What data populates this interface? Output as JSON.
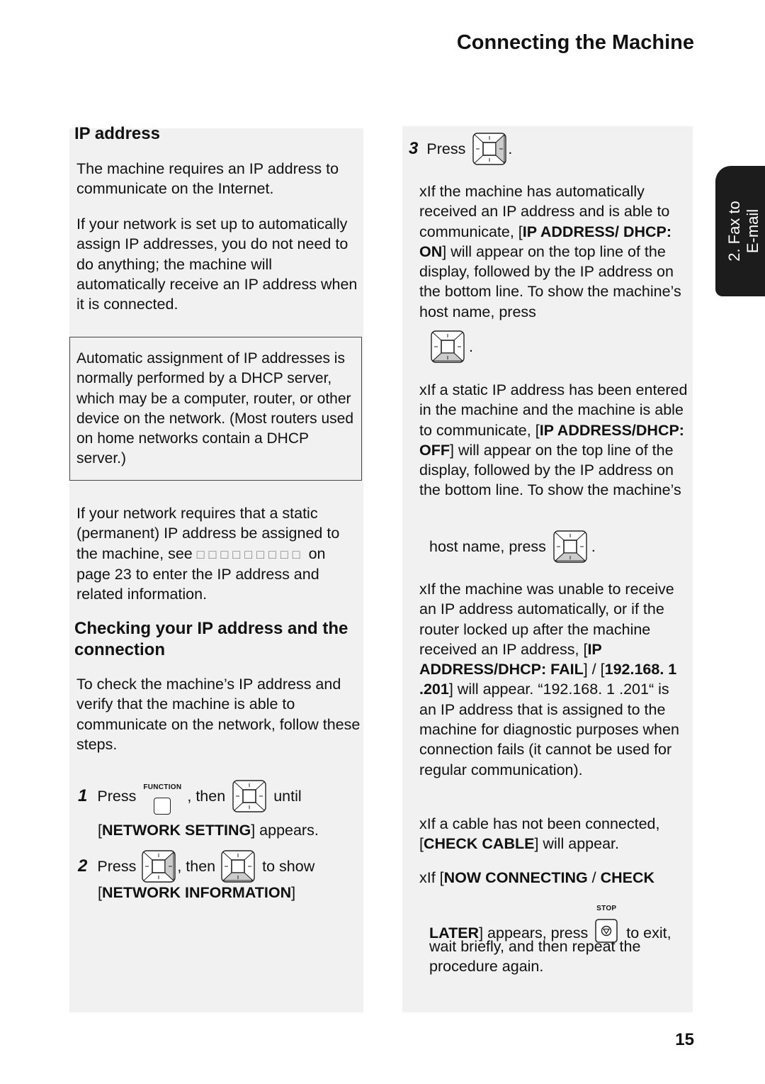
{
  "header": {
    "title": "Connecting the Machine"
  },
  "side_tab": {
    "line1": "2. Fax to",
    "line2": "E-mail"
  },
  "left": {
    "ip_heading": "IP address",
    "p1": "The machine requires an IP address to communicate on the Internet.",
    "p2": "If your network is set up to automatically assign IP addresses, you do not need to do anything; the machine will automatically receive an IP address when it is connected.",
    "note": "Automatic assignment of IP addresses is normally performed by a DHCP server, which may be a computer, router, or other device on the network. (Most routers used on home networks contain a DHCP server.)",
    "p3_a": "If your network requires that a static (permanent) IP address be assigned to the machine, see",
    "p3_glyphs": "□□□□□□□□□",
    "p3_b": "on page 23 to enter the IP address and related information.",
    "check_heading": "Checking your IP address and the connection",
    "p4": "To check the machine’s IP address and verify that the machine is able to communicate on the network, follow these steps.",
    "step1": {
      "num": "1",
      "press": "Press",
      "key_label": "FUNCTION",
      "then": ", then",
      "until": "until",
      "bracket_open": "[",
      "bold": "NETWORK SETTING",
      "rest": "] appears."
    },
    "step2": {
      "num": "2",
      "press": "Press",
      "then": ", then",
      "to_show": "to show",
      "bracket_open": "[",
      "bold": "NETWORK INFORMATION",
      "bracket_close": "]"
    }
  },
  "right": {
    "step3": {
      "num": "3",
      "press": "Press",
      "period": "."
    },
    "bullet_marker": "x",
    "b1": {
      "a": "If the machine has automatically received an IP address and is able to communicate, [",
      "bold1": "IP ADDRESS/ DHCP: ON",
      "b": "] will appear on the top line of the display, followed by the IP address on the bottom line. To show the machine’s host name, press",
      "period": "."
    },
    "b2": {
      "a": "If a static IP address has been entered in the machine and the machine is able to communicate, [",
      "bold1": "IP ADDRESS/DHCP: OFF",
      "b": "] will appear on the top line of the display, followed by the IP address on the bottom line. To show the machine’s",
      "c": "host name, press",
      "period": "."
    },
    "b3": {
      "a": "If the machine was unable to receive an IP address automatically, or if the router locked up after the machine received an IP address, [",
      "bold1": "IP ADDRESS/DHCP: FAIL",
      "mid": "] / [",
      "bold2": "192.168. 1 .201",
      "b": "] will appear. “192.168. 1 .201“ is an IP address that is assigned to the machine for diagnostic purposes when connection fails (it cannot be used for regular communication)."
    },
    "b4": {
      "a": "If a cable has not been connected, [",
      "bold1": "CHECK CABLE",
      "b": "] will appear."
    },
    "b5": {
      "a": "If [",
      "bold1": "NOW CONNECTING",
      "sep": " / ",
      "bold2": "CHECK",
      "bold3": "LATER",
      "b": "] appears, press",
      "key_label": "STOP",
      "c": "to exit,",
      "d": "wait briefly, and then repeat the procedure again."
    }
  },
  "footer": {
    "page_number": "15"
  }
}
